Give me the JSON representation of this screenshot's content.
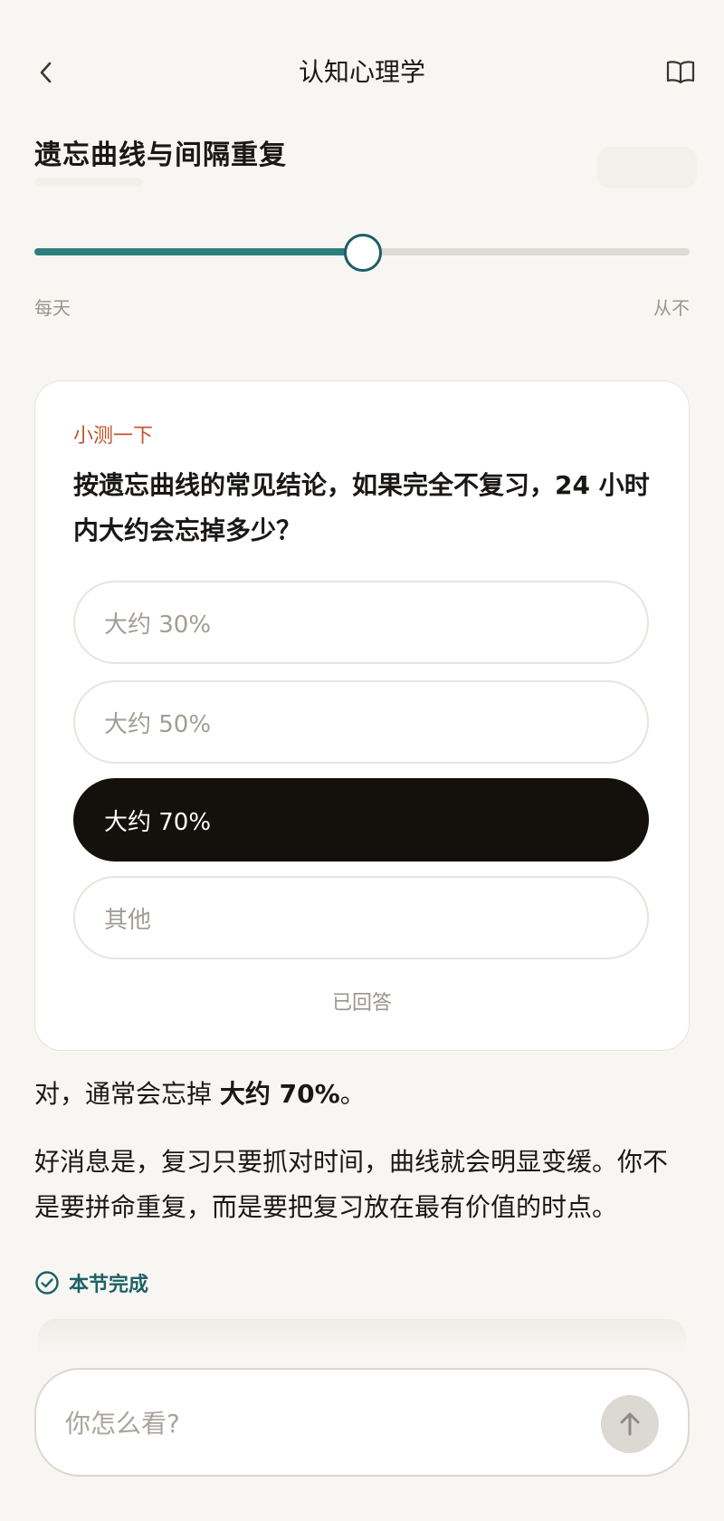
{
  "header": {
    "title": "认知心理学",
    "back_icon": "chevron-left-icon",
    "book_icon": "open-book-icon"
  },
  "lesson": {
    "title": "遗忘曲线与间隔重复"
  },
  "slider": {
    "value_fraction": 0.5,
    "min_label": "每天",
    "max_label": "从不",
    "fill_color": "#2e7f7b"
  },
  "quiz": {
    "kicker": "小测一下",
    "question": "按遗忘曲线的常见结论，如果完全不复习，24 小时内大约会忘掉多少？",
    "options": [
      {
        "label": "大约 30%",
        "selected": false
      },
      {
        "label": "大约 50%",
        "selected": false
      },
      {
        "label": "大约 70%",
        "selected": true
      },
      {
        "label": "其他",
        "selected": false
      }
    ],
    "answered_note": "已回答"
  },
  "response": {
    "line_prefix": "对，通常会忘掉 ",
    "line_bold": "大约 70%",
    "line_suffix": "。",
    "paragraph": "好消息是，复习只要抓对时间，曲线就会明显变缓。你不是要拼命重复，而是要把复习放在最有价值的时点。"
  },
  "status": {
    "done_label": "本节完成",
    "done_icon": "check-circle-icon",
    "accent_color": "#1d6266"
  },
  "composer": {
    "placeholder": "你怎么看?",
    "send_icon": "arrow-up-icon"
  }
}
